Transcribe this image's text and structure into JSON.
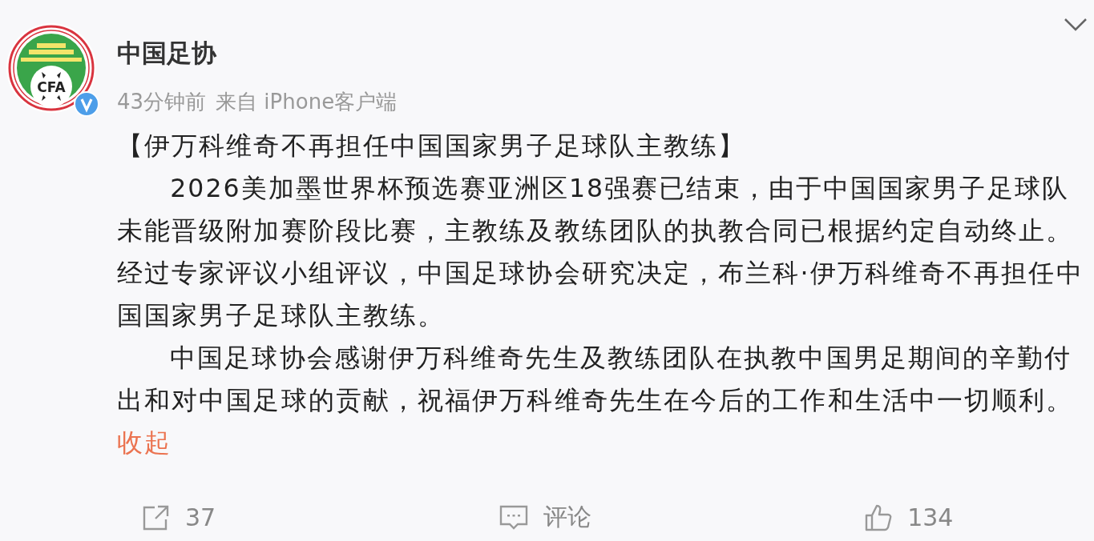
{
  "post": {
    "author": "中国足协",
    "avatar": {
      "logo_text": "CFA",
      "verified": true
    },
    "time": "43分钟前",
    "source": "来自 iPhone客户端",
    "title": "【伊万科维奇不再担任中国国家男子足球队主教练】",
    "paragraphs": [
      "2026美加墨世界杯预选赛亚洲区18强赛已结束，由于中国国家男子足球队未能晋级附加赛阶段比赛，主教练及教练团队的执教合同已根据约定自动终止。经过专家评议小组评议，中国足球协会研究决定，布兰科·伊万科维奇不再担任中国国家男子足球队主教练。",
      "中国足球协会感谢伊万科维奇先生及教练团队在执教中国男足期间的辛勤付出和对中国足球的贡献，祝福伊万科维奇先生在今后的工作和生活中一切顺利。"
    ],
    "collapse_link": "收起"
  },
  "actions": [
    {
      "kind": "share",
      "label": "37"
    },
    {
      "kind": "comment",
      "label": "评论"
    },
    {
      "kind": "like",
      "label": "134"
    }
  ]
}
